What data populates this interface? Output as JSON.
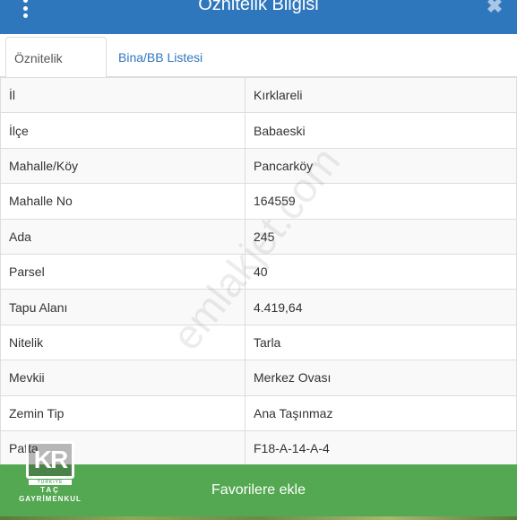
{
  "header": {
    "title": "Öznitelik Bilgisi",
    "menu_icon": "kebab-menu-icon",
    "close_icon": "close-icon",
    "close_glyph": "✖",
    "color": "#2f77bd"
  },
  "tabs": [
    {
      "label": "Öznitelik Bilgisi",
      "active": true
    },
    {
      "label": "Bina/BB Listesi",
      "active": false
    }
  ],
  "attributes": [
    {
      "key": "İl",
      "value": "Kırklareli"
    },
    {
      "key": "İlçe",
      "value": "Babaeski"
    },
    {
      "key": "Mahalle/Köy",
      "value": "Pancarköy"
    },
    {
      "key": "Mahalle No",
      "value": "164559"
    },
    {
      "key": "Ada",
      "value": "245"
    },
    {
      "key": "Parsel",
      "value": "40"
    },
    {
      "key": "Tapu Alanı",
      "value": "4.419,64"
    },
    {
      "key": "Nitelik",
      "value": "Tarla"
    },
    {
      "key": "Mevkii",
      "value": "Merkez Ovası"
    },
    {
      "key": "Zemin Tip",
      "value": "Ana Taşınmaz"
    },
    {
      "key": "Pafta",
      "value": "F18-A-14-A-4"
    }
  ],
  "footer": {
    "favorite_label": "Favorilere ekle",
    "color": "#54a851"
  },
  "watermark": {
    "text": "emlakjet.com"
  },
  "logo": {
    "mark": "KR",
    "band": "TÜRKİYE",
    "name_line1": "TAÇ",
    "name_line2": "GAYRİMENKUL"
  }
}
